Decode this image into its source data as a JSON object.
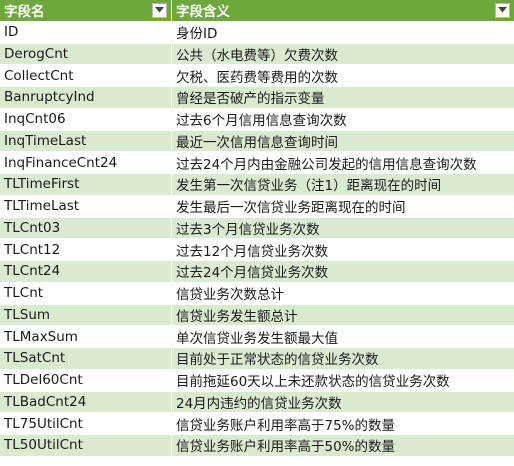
{
  "header": {
    "col1_label": "字段名",
    "col2_label": "字段含义",
    "filter_icon": "dropdown-arrow-icon"
  },
  "colors": {
    "header_bg": "#6fa83a",
    "band_bg": "#d9ead0",
    "row_bg": "#ffffff"
  },
  "rows": [
    {
      "name": "ID",
      "meaning": "身份ID"
    },
    {
      "name": "DerogCnt",
      "meaning": "公共（水电费等）欠费次数"
    },
    {
      "name": "CollectCnt",
      "meaning": "欠税、医药费等费用的次数"
    },
    {
      "name": "BanruptcyInd",
      "meaning": "曾经是否破产的指示变量"
    },
    {
      "name": "InqCnt06",
      "meaning": "过去6个月信用信息查询次数"
    },
    {
      "name": "InqTimeLast",
      "meaning": "最近一次信用信息查询时间"
    },
    {
      "name": "InqFinanceCnt24",
      "meaning": "过去24个月内由金融公司发起的信用信息查询次数"
    },
    {
      "name": "TLTimeFirst",
      "meaning": "发生第一次信贷业务（注1）距离现在的时间"
    },
    {
      "name": "TLTimeLast",
      "meaning": "发生最后一次信贷业务距离现在的时间"
    },
    {
      "name": "TLCnt03",
      "meaning": "过去3个月信贷业务次数"
    },
    {
      "name": "TLCnt12",
      "meaning": "过去12个月信贷业务次数"
    },
    {
      "name": "TLCnt24",
      "meaning": "过去24个月信贷业务次数"
    },
    {
      "name": "TLCnt",
      "meaning": "信贷业务次数总计"
    },
    {
      "name": "TLSum",
      "meaning": "信贷业务发生额总计"
    },
    {
      "name": "TLMaxSum",
      "meaning": "单次信贷业务发生额最大值"
    },
    {
      "name": "TLSatCnt",
      "meaning": "目前处于正常状态的信贷业务次数"
    },
    {
      "name": "TLDel60Cnt",
      "meaning": "目前拖延60天以上未还款状态的信贷业务次数"
    },
    {
      "name": "TLBadCnt24",
      "meaning": "24月内违约的信贷业务次数"
    },
    {
      "name": "TL75UtilCnt",
      "meaning": "信贷业务账户利用率高于75%的数量"
    },
    {
      "name": "TL50UtilCnt",
      "meaning": "信贷业务账户利用率高于50%的数量"
    }
  ]
}
